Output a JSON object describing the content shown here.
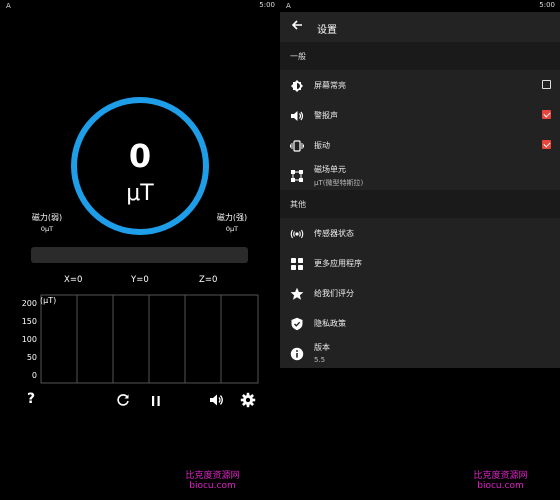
{
  "status_bar": {
    "left_icon": "A",
    "time": "5:00"
  },
  "meter": {
    "value": "0",
    "unit": "μT",
    "weak_label": "磁力(弱)",
    "weak_value": "0μT",
    "strong_label": "磁力(强)",
    "strong_value": "0μT",
    "level_fraction": 0,
    "x": "X=0",
    "y": "Y=0",
    "z": "Z=0",
    "accent": "#1e9ee8"
  },
  "chart_data": {
    "type": "line",
    "ylabel": "(μT)",
    "y_ticks": [
      "200",
      "150",
      "100",
      "50",
      "0"
    ],
    "y_tick_values": [
      200,
      150,
      100,
      50,
      0
    ],
    "ylim": [
      0,
      200
    ],
    "grid": true,
    "series": [
      {
        "values": []
      }
    ]
  },
  "toolbar": {
    "help": "?",
    "icons": [
      "help-icon",
      "refresh-icon",
      "pause-icon",
      "volume-icon",
      "settings-icon"
    ]
  },
  "watermark": {
    "line1": "比克度资源网",
    "line2": "biocu.com"
  },
  "settings": {
    "title": "设置",
    "section_general": "一般",
    "screen_on": "屏幕常亮",
    "screen_on_checked": false,
    "alarm": "警报声",
    "alarm_checked": true,
    "vibrate": "振动",
    "vibrate_checked": true,
    "unit_label": "磁场单元",
    "unit_value": "μT(微型特斯拉)",
    "section_other": "其他",
    "sensor_status": "传感器状态",
    "more_apps": "更多应用程序",
    "rate": "给我们评分",
    "privacy": "隐私政策",
    "version_label": "版本",
    "version_value": "5.5",
    "check_color": "#e8453c"
  }
}
